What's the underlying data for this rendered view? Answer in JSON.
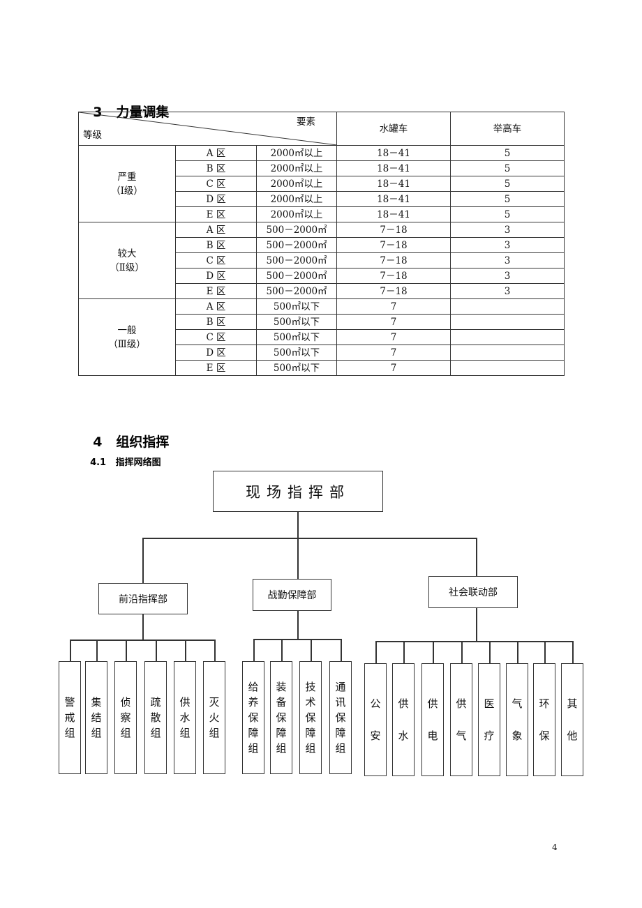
{
  "section3": {
    "number": "3",
    "title": "力量调集"
  },
  "table": {
    "header": {
      "diag_top": "要素",
      "diag_bottom": "等级",
      "col1": "水罐车",
      "col2": "举高车"
    },
    "groups": [
      {
        "level": "严重",
        "grade": "（Ⅰ级）",
        "rows": [
          {
            "zone": "A 区",
            "area": "2000㎡以上",
            "tankers": "18－41",
            "aerial": "5"
          },
          {
            "zone": "B 区",
            "area": "2000㎡以上",
            "tankers": "18－41",
            "aerial": "5"
          },
          {
            "zone": "C 区",
            "area": "2000㎡以上",
            "tankers": "18－41",
            "aerial": "5"
          },
          {
            "zone": "D 区",
            "area": "2000㎡以上",
            "tankers": "18－41",
            "aerial": "5"
          },
          {
            "zone": "E 区",
            "area": "2000㎡以上",
            "tankers": "18－41",
            "aerial": "5"
          }
        ]
      },
      {
        "level": "较大",
        "grade": "（Ⅱ级）",
        "rows": [
          {
            "zone": "A 区",
            "area": "500－2000㎡",
            "tankers": "7－18",
            "aerial": "3"
          },
          {
            "zone": "B 区",
            "area": "500－2000㎡",
            "tankers": "7－18",
            "aerial": "3"
          },
          {
            "zone": "C 区",
            "area": "500－2000㎡",
            "tankers": "7－18",
            "aerial": "3"
          },
          {
            "zone": "D 区",
            "area": "500－2000㎡",
            "tankers": "7－18",
            "aerial": "3"
          },
          {
            "zone": "E 区",
            "area": "500－2000㎡",
            "tankers": "7－18",
            "aerial": "3"
          }
        ]
      },
      {
        "level": "一般",
        "grade": "（Ⅲ级）",
        "rows": [
          {
            "zone": "A 区",
            "area": "500㎡以下",
            "tankers": "7",
            "aerial": ""
          },
          {
            "zone": "B 区",
            "area": "500㎡以下",
            "tankers": "7",
            "aerial": ""
          },
          {
            "zone": "C 区",
            "area": "500㎡以下",
            "tankers": "7",
            "aerial": ""
          },
          {
            "zone": "D 区",
            "area": "500㎡以下",
            "tankers": "7",
            "aerial": ""
          },
          {
            "zone": "E 区",
            "area": "500㎡以下",
            "tankers": "7",
            "aerial": ""
          }
        ]
      }
    ]
  },
  "section4": {
    "number": "4",
    "title": "组织指挥"
  },
  "subsection41": {
    "number": "4.1",
    "title": "指挥网络图"
  },
  "org": {
    "root": "现场指挥部",
    "branches": [
      {
        "name": "前沿指挥部",
        "children": [
          "警戒组",
          "集结组",
          "侦察组",
          "疏散组",
          "供水组",
          "灭火组"
        ]
      },
      {
        "name": "战勤保障部",
        "children": [
          "给养保障组",
          "装备保障组",
          "技术保障组",
          "通讯保障组"
        ]
      },
      {
        "name": "社会联动部",
        "children": [
          "公安",
          "供水",
          "供电",
          "供气",
          "医疗",
          "气象",
          "环保",
          "其他"
        ]
      }
    ]
  },
  "page_number": "4"
}
